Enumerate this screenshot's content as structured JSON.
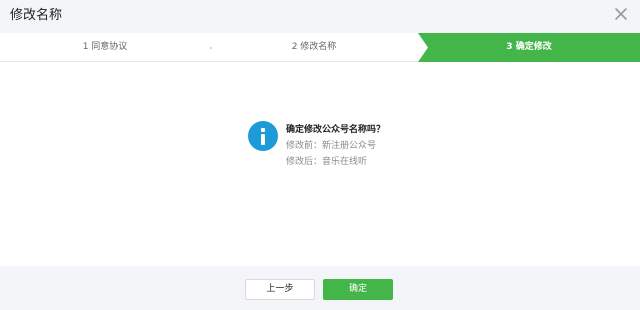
{
  "dialog": {
    "title": "修改名称",
    "close_icon": "close-icon"
  },
  "steps": [
    {
      "label": "1 同意协议",
      "active": false
    },
    {
      "label": "2 修改名称",
      "active": false
    },
    {
      "label": "3 确定修改",
      "active": true
    }
  ],
  "colors": {
    "accent_green": "#44b549",
    "info_blue": "#1d9bd8",
    "header_bg": "#f4f5f9"
  },
  "confirm": {
    "icon": "info-icon",
    "question": "确定修改公众号名称吗？",
    "before": "修改前：新注册公众号",
    "after": "修改后：音乐在线听"
  },
  "footer": {
    "prev_label": "上一步",
    "ok_label": "确定"
  }
}
